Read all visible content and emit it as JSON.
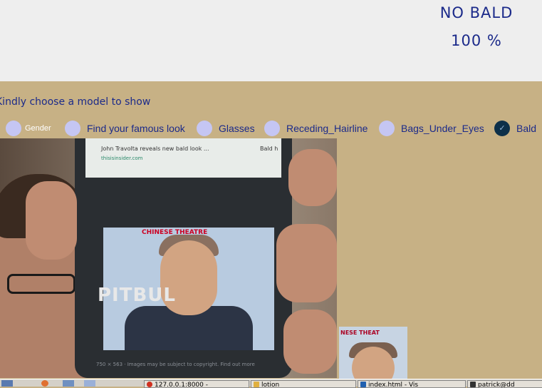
{
  "result": {
    "label": "NO BALD",
    "value": "100 %"
  },
  "prompt": "Kindly choose a model to show",
  "models": [
    {
      "label": "Gender",
      "selected": false
    },
    {
      "label": "Find your famous look",
      "selected": false
    },
    {
      "label": "Glasses",
      "selected": false
    },
    {
      "label": "Receding_Hairline",
      "selected": false
    },
    {
      "label": "Bags_Under_Eyes",
      "selected": false
    },
    {
      "label": "Bald",
      "selected": true
    }
  ],
  "camera": {
    "phone_caption": "John Travolta reveals new bald look ...",
    "phone_url": "thisisinsider.com",
    "phone_side_text": "Bald h",
    "photo_sign": "CHINESE THEATRE",
    "photo_brand": "PITBUL",
    "photo_footer": "750 × 563 · Images may be subject to copyright. Find out more"
  },
  "thumbnail": {
    "sign": "NESE THEAT"
  },
  "taskbar": {
    "items": [
      {
        "label": "127.0.0.1:8000 -",
        "icon_color": "#d03020"
      },
      {
        "label": "lotion",
        "icon_color": "#e0b040"
      },
      {
        "label": "index.html - Vis",
        "icon_color": "#2060b0"
      },
      {
        "label": "patrick@dd",
        "icon_color": "#333333"
      }
    ]
  },
  "colors": {
    "accent": "#1b2a8a",
    "panel": "#c7b185",
    "radio": "#c5c6f3",
    "radio_selected": "#0d3049"
  }
}
